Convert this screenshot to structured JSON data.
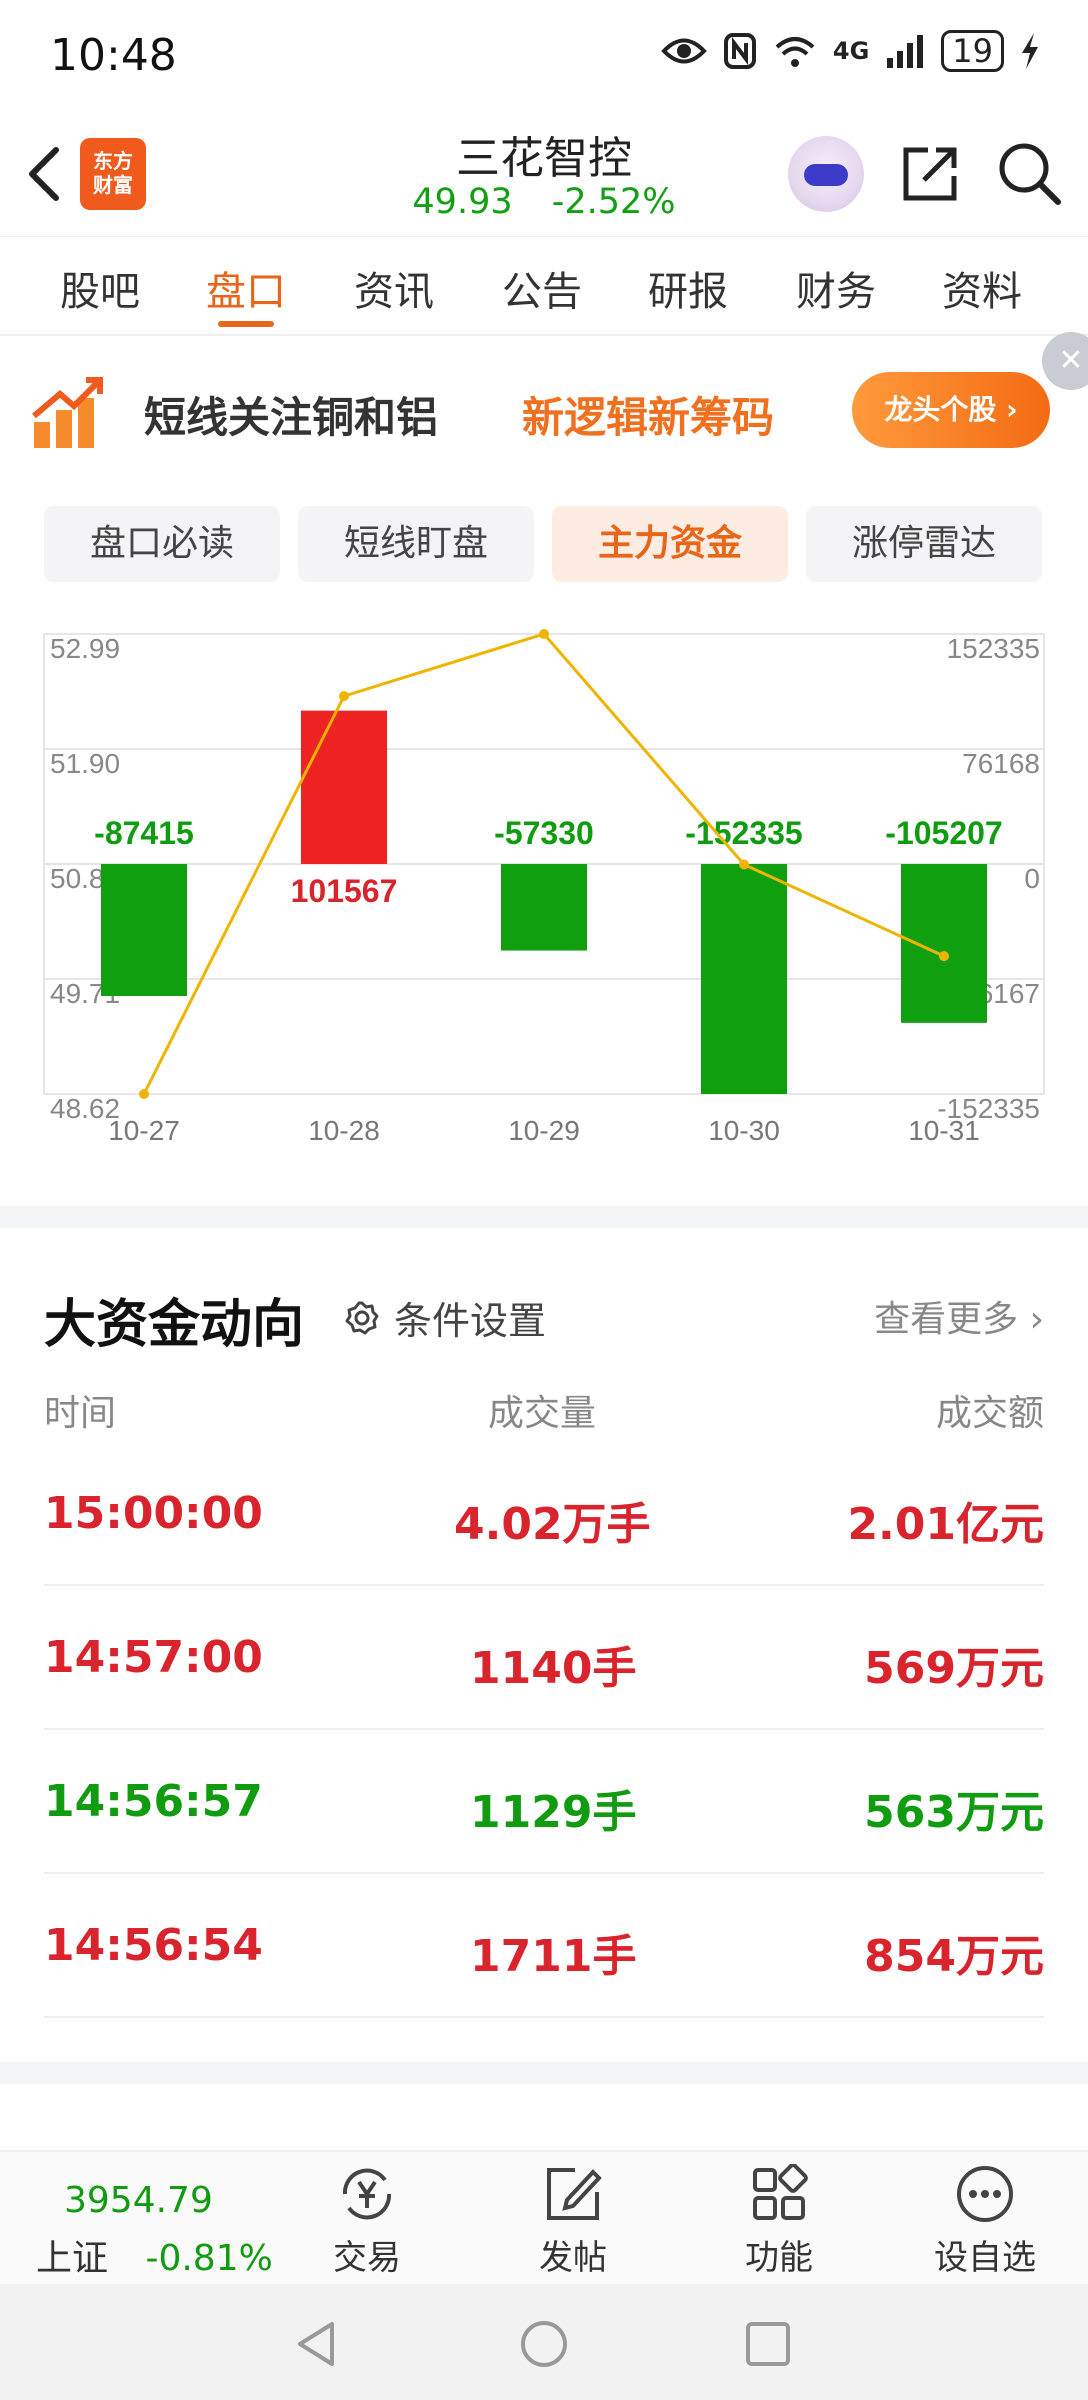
{
  "status_bar": {
    "time": "10:48",
    "network": "4G",
    "battery": "19"
  },
  "header": {
    "logo_line1": "东方",
    "logo_line2": "财富",
    "stock_name": "三花智控",
    "price": "49.93",
    "change_pct": "-2.52%"
  },
  "tabs": [
    {
      "label": "股吧"
    },
    {
      "label": "盘口"
    },
    {
      "label": "资讯"
    },
    {
      "label": "公告"
    },
    {
      "label": "研报"
    },
    {
      "label": "财务"
    },
    {
      "label": "资料"
    }
  ],
  "banner": {
    "text": "短线关注铜和铝",
    "accent": "新逻辑新筹码",
    "button": "龙头个股 ›"
  },
  "segments": [
    {
      "label": "盘口必读"
    },
    {
      "label": "短线盯盘"
    },
    {
      "label": "主力资金"
    },
    {
      "label": "涨停雷达"
    }
  ],
  "chart_data": {
    "type": "bar",
    "categories": [
      "10-27",
      "10-28",
      "10-29",
      "10-30",
      "10-31"
    ],
    "series": [
      {
        "values": [
          -87415,
          101567,
          -57330,
          -152335,
          -105207
        ],
        "type": "bar"
      },
      {
        "values": [
          48.62,
          52.4,
          52.99,
          50.8,
          49.93
        ],
        "type": "line"
      }
    ],
    "left_ticks": [
      "52.99",
      "51.90",
      "50.81",
      "49.71",
      "48.62"
    ],
    "right_ticks": [
      "152335",
      "76168",
      "0",
      "-76167",
      "-152335"
    ],
    "bar_labels": [
      "-87415",
      "101567",
      "-57330",
      "-152335",
      "-105207"
    ],
    "ylim_bar": [
      -152335,
      152335
    ],
    "ylim_price": [
      48.62,
      52.99
    ],
    "colors": {
      "positive": "#ee2222",
      "negative": "#0f9f0f",
      "line": "#f0b400"
    }
  },
  "flow": {
    "title": "大资金动向",
    "settings": "条件设置",
    "more": "查看更多",
    "headers": {
      "time": "时间",
      "volume": "成交量",
      "amount": "成交额"
    },
    "rows": [
      {
        "time": "15:00:00",
        "volume": "4.02万手",
        "amount": "2.01亿元",
        "color": "red"
      },
      {
        "time": "14:57:00",
        "volume": "1140手",
        "amount": "569万元",
        "color": "red"
      },
      {
        "time": "14:56:57",
        "volume": "1129手",
        "amount": "563万元",
        "color": "green"
      },
      {
        "time": "14:56:54",
        "volume": "1711手",
        "amount": "854万元",
        "color": "red"
      }
    ]
  },
  "bottom_nav": {
    "index_value": "3954.79",
    "index_name": "上证",
    "index_change": "-0.81%",
    "items": [
      {
        "label": "交易",
        "icon": "yen-exchange-icon"
      },
      {
        "label": "发帖",
        "icon": "edit-icon"
      },
      {
        "label": "功能",
        "icon": "grid-icon"
      },
      {
        "label": "设自选",
        "icon": "more-dots-icon"
      }
    ]
  }
}
